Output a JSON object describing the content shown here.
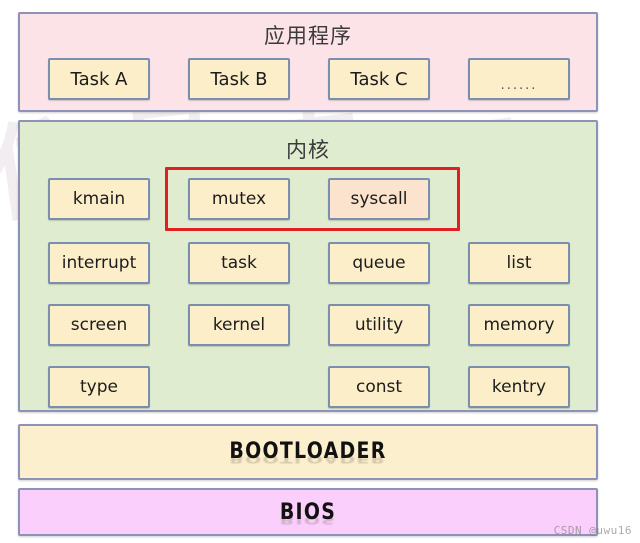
{
  "diagram": {
    "type": "layered-architecture",
    "layers": [
      {
        "id": "application",
        "title": "应用程序",
        "background_color": "#fbe3e8",
        "border_color": "#8f92b8",
        "modules": [
          "Task A",
          "Task B",
          "Task C",
          "......"
        ]
      },
      {
        "id": "kernel",
        "title": "内核",
        "background_color": "#dfeccf",
        "border_color": "#8f92b8",
        "rows": [
          [
            "kmain",
            "mutex",
            "syscall",
            ""
          ],
          [
            "interrupt",
            "task",
            "queue",
            "list"
          ],
          [
            "screen",
            "kernel",
            "utility",
            "memory"
          ],
          [
            "type",
            "",
            "const",
            "kentry"
          ]
        ],
        "highlight": {
          "color": "#e02020",
          "modules": [
            "mutex",
            "syscall"
          ]
        },
        "accent_module": {
          "name": "syscall",
          "color": "#fbe3cd"
        }
      },
      {
        "id": "bootloader",
        "title": "BOOTLOADER",
        "background_color": "#fcefcd",
        "border_color": "#8f92b8"
      },
      {
        "id": "bios",
        "title": "BIOS",
        "background_color": "#fbcffb",
        "border_color": "#8f92b8"
      }
    ]
  },
  "app": {
    "title": "应用程序",
    "tasks": [
      {
        "label": "Task A"
      },
      {
        "label": "Task B"
      },
      {
        "label": "Task C"
      },
      {
        "label": "......"
      }
    ]
  },
  "kernel": {
    "title": "内核",
    "row1": {
      "kmain": "kmain",
      "mutex": "mutex",
      "syscall": "syscall"
    },
    "row2": {
      "interrupt": "interrupt",
      "task": "task",
      "queue": "queue",
      "list": "list"
    },
    "row3": {
      "screen": "screen",
      "kernel": "kernel",
      "utility": "utility",
      "memory": "memory"
    },
    "row4": {
      "type": "type",
      "const": "const",
      "kentry": "kentry"
    }
  },
  "bootloader": {
    "label": "BOOTLOADER"
  },
  "bios": {
    "label": "BIOS"
  },
  "watermark": {
    "credit": "CSDN @uwu16",
    "background_glyphs": [
      "信",
      "息",
      "来",
      "源",
      "技",
      "术"
    ]
  },
  "colors": {
    "module_fill": "#fbeec9",
    "module_border": "#7a8fb0",
    "highlight_red": "#e02020",
    "app_bg": "#fbe3e8",
    "kernel_bg": "#dfeccf",
    "bootloader_bg": "#fcefcd",
    "bios_bg": "#fbcffb"
  }
}
